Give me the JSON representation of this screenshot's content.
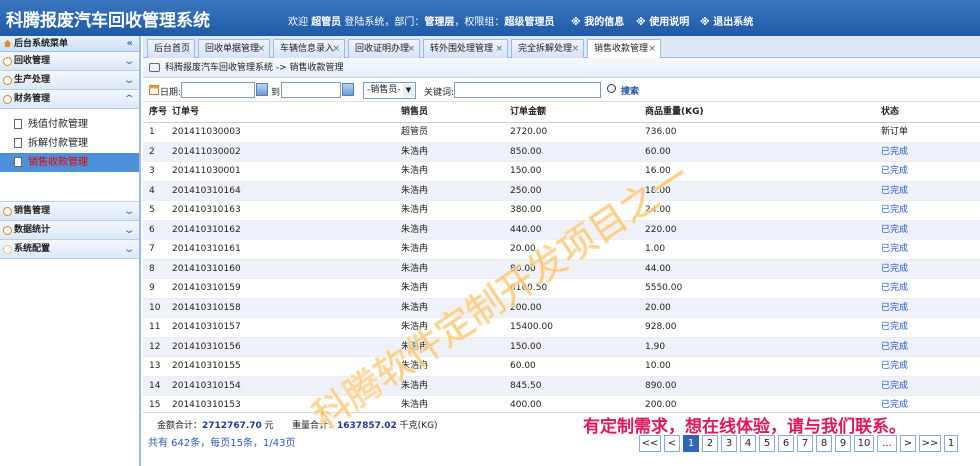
{
  "header": {
    "title": "科腾报废汽车回收管理系统",
    "welcome_prefix": "欢迎",
    "user": "超管员",
    "info_mid": "登陆系统，部门：",
    "dept": "管理层",
    "info_group": "，权限组：",
    "group": "超级管理员",
    "links": [
      "※ 我的信息",
      "※ 使用说明",
      "※ 退出系统"
    ]
  },
  "sidebar": {
    "title": "后台系统菜单",
    "groups": [
      {
        "label": "回收管理"
      },
      {
        "label": "生产处理"
      },
      {
        "label": "财务管理"
      },
      {
        "label": "销售管理"
      },
      {
        "label": "数据统计"
      },
      {
        "label": "系统配置"
      }
    ],
    "finance_items": [
      "残值付款管理",
      "拆解付款管理",
      "销售收款管理"
    ]
  },
  "tabs": [
    "后台首页",
    "回收单据管理",
    "车辆信息录入",
    "回收证明办理",
    "转外围处理管理",
    "完全拆解处理",
    "销售收款管理"
  ],
  "breadcrumb": "科腾报废汽车回收管理系统 -> 销售收款管理",
  "filter": {
    "date_label": "日期:",
    "to_label": "到",
    "seller_select": "-销售员-",
    "keyword_label": "关键词:",
    "search_label": "搜索"
  },
  "table": {
    "columns": [
      "序号",
      "订单号",
      "销售员",
      "订单金额",
      "商品重量(KG)",
      "状态"
    ],
    "rows": [
      [
        "1",
        "201411030003",
        "超管员",
        "2720.00",
        "736.00",
        "新订单"
      ],
      [
        "2",
        "201411030002",
        "朱浩冉",
        "850.00",
        "60.00",
        "已完成"
      ],
      [
        "3",
        "201411030001",
        "朱浩冉",
        "150.00",
        "16.00",
        "已完成"
      ],
      [
        "4",
        "201410310164",
        "朱浩冉",
        "250.00",
        "18.00",
        "已完成"
      ],
      [
        "5",
        "201410310163",
        "朱浩冉",
        "380.00",
        "24.00",
        "已完成"
      ],
      [
        "6",
        "201410310162",
        "朱浩冉",
        "440.00",
        "220.00",
        "已完成"
      ],
      [
        "7",
        "201410310161",
        "朱浩冉",
        "20.00",
        "1.00",
        "已完成"
      ],
      [
        "8",
        "201410310160",
        "朱浩冉",
        "80.00",
        "44.00",
        "已完成"
      ],
      [
        "9",
        "201410310159",
        "朱浩冉",
        "6160.50",
        "5550.00",
        "已完成"
      ],
      [
        "10",
        "201410310158",
        "朱浩冉",
        "200.00",
        "20.00",
        "已完成"
      ],
      [
        "11",
        "201410310157",
        "朱浩冉",
        "15400.00",
        "928.00",
        "已完成"
      ],
      [
        "12",
        "201410310156",
        "朱浩冉",
        "150.00",
        "1.90",
        "已完成"
      ],
      [
        "13",
        "201410310155",
        "朱浩冉",
        "60.00",
        "10.00",
        "已完成"
      ],
      [
        "14",
        "201410310154",
        "朱浩冉",
        "845.50",
        "890.00",
        "已完成"
      ],
      [
        "15",
        "201410310153",
        "朱浩冉",
        "400.00",
        "200.00",
        "已完成"
      ]
    ]
  },
  "summary": {
    "amount_label": "金额合计：",
    "amount_value": "2712767.70",
    "amount_unit": "元",
    "weight_label": "重量合计：",
    "weight_value": "1637857.02",
    "weight_unit": "千克(KG)"
  },
  "pagination": {
    "info": "共有 642条，每页15条，1/43页",
    "buttons": [
      "<<",
      "<",
      "1",
      "2",
      "3",
      "4",
      "5",
      "6",
      "7",
      "8",
      "9",
      "10",
      "...",
      ">",
      ">>",
      "1"
    ],
    "current": "1"
  },
  "promo": "有定制需求，想在线体验，请与我们联系。",
  "watermark": "科腾软件定制开发项目之一"
}
